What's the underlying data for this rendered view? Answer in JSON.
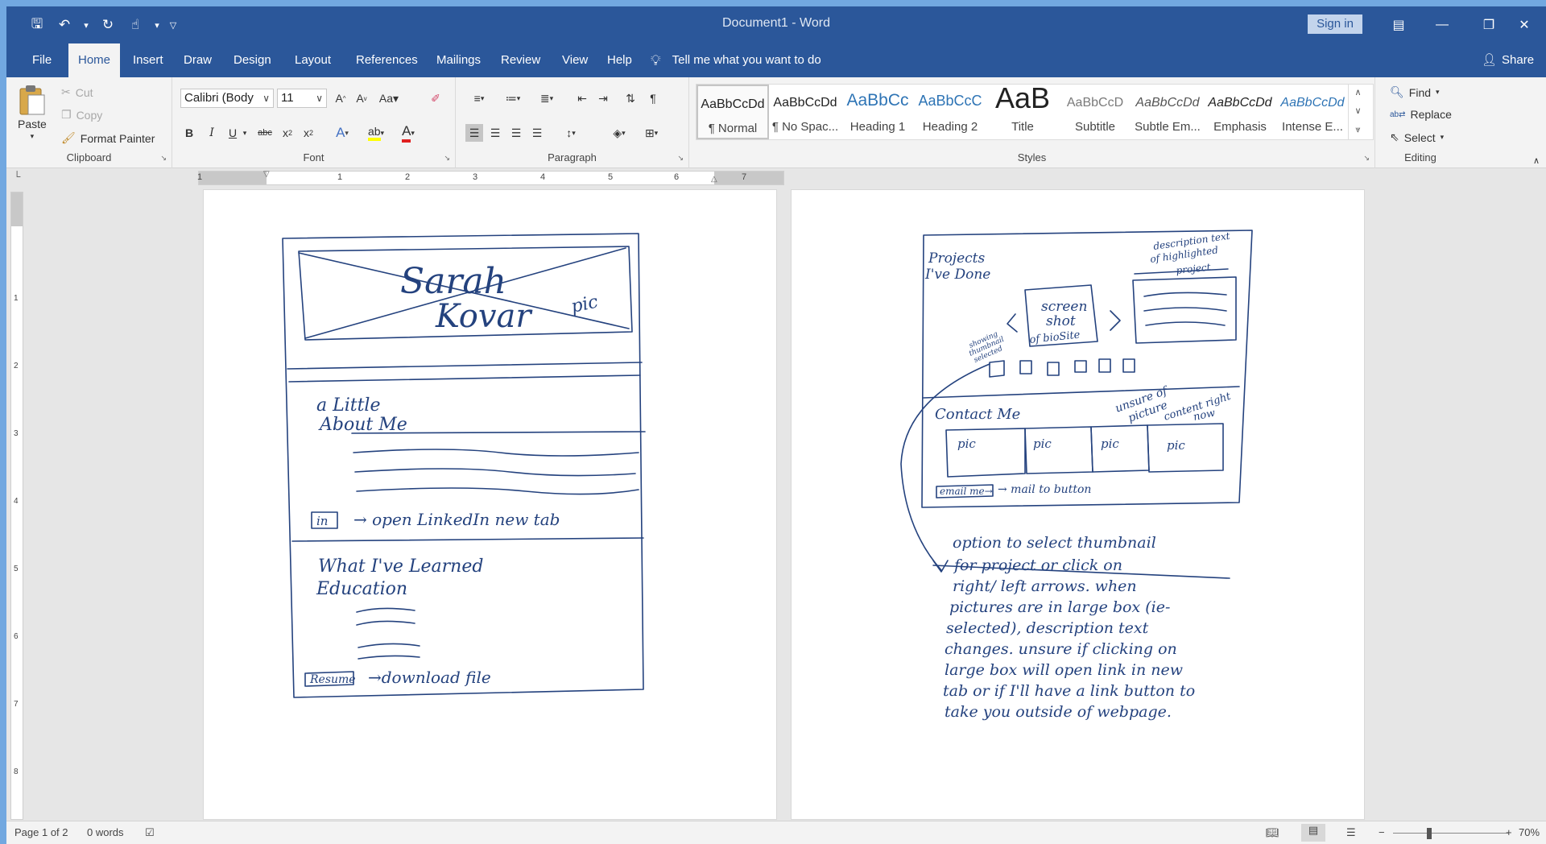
{
  "window": {
    "title": "Document1 - Word",
    "sign_in": "Sign in"
  },
  "tabs": [
    "File",
    "Home",
    "Insert",
    "Draw",
    "Design",
    "Layout",
    "References",
    "Mailings",
    "Review",
    "View",
    "Help"
  ],
  "active_tab": "Home",
  "tell_me": "Tell me what you want to do",
  "share": "Share",
  "clipboard": {
    "paste": "Paste",
    "cut": "Cut",
    "copy": "Copy",
    "format_painter": "Format Painter",
    "label": "Clipboard"
  },
  "font": {
    "family": "Calibri (Body",
    "size": "11",
    "label": "Font"
  },
  "paragraph": {
    "label": "Paragraph"
  },
  "styles": {
    "label": "Styles",
    "items": [
      {
        "preview": "AaBbCcDd",
        "name": "¶ Normal"
      },
      {
        "preview": "AaBbCcDd",
        "name": "¶ No Spac..."
      },
      {
        "preview": "AaBbCc",
        "name": "Heading 1"
      },
      {
        "preview": "AaBbCcC",
        "name": "Heading 2"
      },
      {
        "preview": "AaB",
        "name": "Title"
      },
      {
        "preview": "AaBbCcD",
        "name": "Subtitle"
      },
      {
        "preview": "AaBbCcDd",
        "name": "Subtle Em..."
      },
      {
        "preview": "AaBbCcDd",
        "name": "Emphasis"
      },
      {
        "preview": "AaBbCcDd",
        "name": "Intense E..."
      }
    ]
  },
  "editing": {
    "find": "Find",
    "replace": "Replace",
    "select": "Select",
    "label": "Editing"
  },
  "ruler_numbers": [
    "1",
    "1",
    "2",
    "3",
    "4",
    "5",
    "6",
    "7"
  ],
  "vruler_numbers": [
    "1",
    "2",
    "3",
    "4",
    "5",
    "6",
    "7",
    "8"
  ],
  "page1": {
    "name_line1": "Sarah",
    "name_line2": "Kovar",
    "pic": "pic",
    "about_line1": "a Little",
    "about_line2": "About Me",
    "linkedin_icon": "in",
    "linkedin_note": "→ open LinkedIn new tab",
    "learned_line1": "What I've Learned",
    "learned_line2": "Education",
    "resume": "Resume",
    "resume_note": "→download file"
  },
  "page2": {
    "projects_line1": "Projects",
    "projects_line2": "I've Done",
    "desc_line1": "description text",
    "desc_line2": "of highlighted",
    "desc_line3": "project",
    "screen_line1": "screen",
    "screen_line2": "shot",
    "screen_line3": "of bioSite",
    "showing_line1": "showing",
    "showing_line2": "thumbnail",
    "showing_line3": "selected",
    "contact": "Contact Me",
    "unsure_line1": "unsure of",
    "unsure_line2": "picture",
    "unsure_line3": "content right",
    "unsure_line4": "now",
    "pic": "pic",
    "email_btn": "email me→",
    "mailto": "→ mail to button",
    "note_lines": [
      "option to select thumbnail",
      "for project or click on",
      "right/ left arrows. when",
      "pictures are in large box (ie-",
      "selected), description text",
      "changes. unsure if clicking on",
      "large box will open link in new",
      "tab or if I'll have a link button to",
      "take you outside of webpage."
    ]
  },
  "status": {
    "page": "Page 1 of 2",
    "words": "0 words",
    "zoom": "70%"
  }
}
